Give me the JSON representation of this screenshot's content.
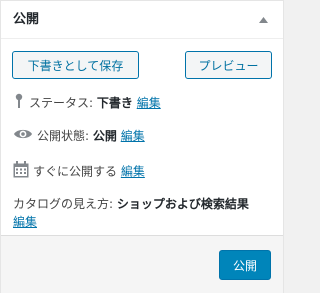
{
  "panel": {
    "title": "公開"
  },
  "actions": {
    "save_draft_label": "下書きとして保存",
    "preview_label": "プレビュー"
  },
  "status": {
    "label": "ステータス: ",
    "value": "下書き",
    "edit_label": "編集"
  },
  "visibility": {
    "label": "公開状態: ",
    "value": "公開",
    "edit_label": "編集"
  },
  "schedule": {
    "label": "すぐに公開する",
    "edit_label": "編集"
  },
  "catalog": {
    "label": "カタログの見え方: ",
    "value": "ショップおよび検索結果",
    "edit_label": "編集"
  },
  "footer": {
    "publish_label": "公開"
  },
  "colors": {
    "accent": "#0073aa",
    "primary_button": "#0085ba",
    "icon": "#82878c"
  },
  "icons": {
    "collapse": "triangle-up-icon",
    "status": "pin-icon",
    "visibility": "eye-icon",
    "schedule": "calendar-icon"
  }
}
